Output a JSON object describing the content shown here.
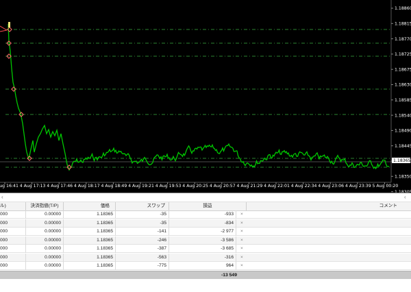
{
  "chart": {
    "price_ticks": [
      "1.18860",
      "1.18815",
      "1.18770",
      "1.18725",
      "1.18675",
      "1.18630",
      "1.18585",
      "1.18540",
      "1.18490",
      "1.18445",
      "1.18395",
      "1.18350",
      "1.18305"
    ],
    "current_price": "1.18365",
    "time_ticks": [
      "4 Aug 16:41",
      "4 Aug 17:13",
      "4 Aug 17:46",
      "4 Aug 18:17",
      "4 Aug 18:49",
      "4 Aug 19:21",
      "4 Aug 19:53",
      "4 Aug 20:25",
      "4 Aug 20:57",
      "4 Aug 21:29",
      "4 Aug 22:01",
      "4 Aug 22:34",
      "4 Aug 23:06",
      "4 Aug 23:39",
      "5 Aug 00:20"
    ],
    "colors": {
      "background": "#000000",
      "line": "#00c800",
      "level_lines": "#3cb043",
      "grid": "#2a2a2a",
      "markers": "#ff6b6b",
      "current_price_box": "#ffffff"
    }
  },
  "terminal": {
    "headers": [
      "ル)",
      "決済指値(T/P)",
      "価格",
      "スワップ",
      "損益",
      "コメント"
    ],
    "rows": [
      {
        "stop": "000",
        "tp": "0.00000",
        "price": "1.18365",
        "swap": "-35",
        "profit": "-933"
      },
      {
        "stop": "000",
        "tp": "0.00000",
        "price": "1.18365",
        "swap": "-35",
        "profit": "-834"
      },
      {
        "stop": "000",
        "tp": "0.00000",
        "price": "1.18365",
        "swap": "-141",
        "profit": "-2 977"
      },
      {
        "stop": "000",
        "tp": "0.00000",
        "price": "1.18365",
        "swap": "-246",
        "profit": "-3 586"
      },
      {
        "stop": "000",
        "tp": "0.00000",
        "price": "1.18365",
        "swap": "-387",
        "profit": "-3 685"
      },
      {
        "stop": "000",
        "tp": "0.00000",
        "price": "1.18365",
        "swap": "-563",
        "profit": "-316"
      },
      {
        "stop": "000",
        "tp": "0.00000",
        "price": "1.18365",
        "swap": "-775",
        "profit": "964"
      }
    ],
    "close_glyph": "×",
    "total_profit": "-13 549",
    "scroll_glyph": "‹"
  }
}
